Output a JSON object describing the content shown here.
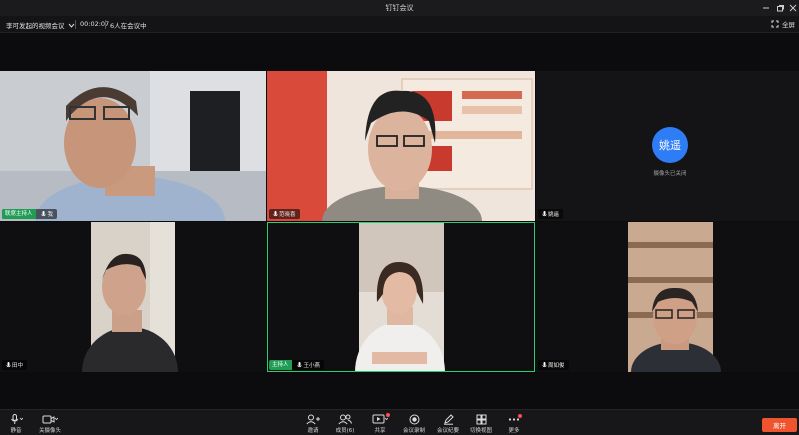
{
  "window": {
    "title": "钉钉会议"
  },
  "infobar": {
    "meeting_name": "李可发起的视频会议",
    "duration": "00:02:07",
    "participants": "6人在会议中",
    "fullscreen_label": "全屏"
  },
  "tiles": [
    {
      "name": "我",
      "role": "联席主持人",
      "camera_on": true
    },
    {
      "name": "范晓喜",
      "role": "",
      "camera_on": true
    },
    {
      "name": "姚遥",
      "role": "",
      "camera_on": false,
      "avatar_text": "姚遥",
      "camera_off_text": "摄像头已关闭"
    },
    {
      "name": "田中",
      "role": "",
      "camera_on": true
    },
    {
      "name": "王小燕",
      "role": "主持人",
      "camera_on": true,
      "speaking": true
    },
    {
      "name": "周如俊",
      "role": "",
      "camera_on": true
    }
  ],
  "toolbar": {
    "mute": "静音",
    "camera": "关摄像头",
    "invite": "邀请",
    "members": "成员(6)",
    "share": "共享",
    "record": "会议录制",
    "minutes": "会议纪要",
    "layout": "切换视图",
    "more": "更多",
    "leave": "离开"
  },
  "colors": {
    "host_badge": "#1f9d55",
    "leave": "#f0542f",
    "avatar": "#2f7df6",
    "speaking_border": "#2ecc71"
  }
}
